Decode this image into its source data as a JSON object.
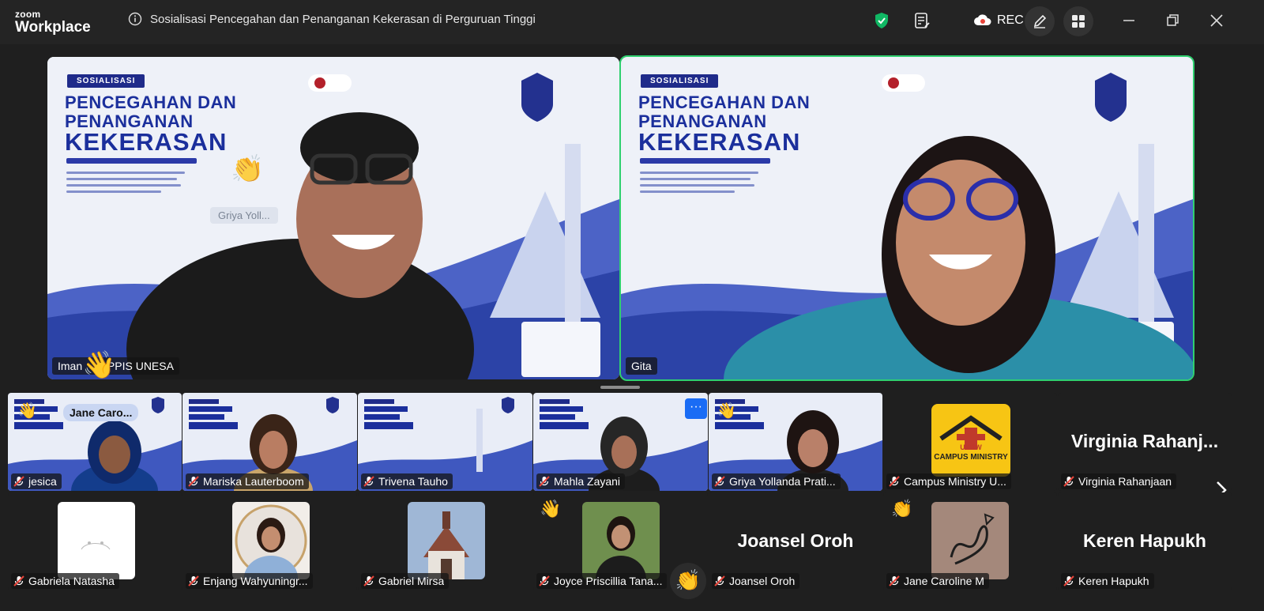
{
  "app": {
    "logo_small": "zoom",
    "logo_big": "Workplace",
    "meeting_title": "Sosialisasi Pencegahan dan Penanganan Kekerasan di Perguruan Tinggi",
    "rec_label": "REC"
  },
  "colors": {
    "active_speaker": "#2fd06f",
    "shield": "#10b864",
    "muted_mic": "#e8443a",
    "slide_navy": "#1b2f9c"
  },
  "slide": {
    "ribbon": "SOSIALISASI",
    "heading_line1": "PENCEGAHAN DAN",
    "heading_line2": "PENANGANAN",
    "heading_line3": "KEKERASAN"
  },
  "speakers": [
    {
      "name_start": "Iman",
      "name_end": "_PPIS UNESA",
      "reaction": "👋"
    },
    {
      "name": "Gita"
    }
  ],
  "stage_chip": "Griya  Yoll...",
  "gallery_row1": [
    {
      "name": "jesica",
      "hover": "Jane Caro...",
      "reaction": "👋"
    },
    {
      "name": "Mariska Lauterboom"
    },
    {
      "name": "Trivena Tauho"
    },
    {
      "name": "Mahla Zayani"
    },
    {
      "name": "Griya Yollanda Prati...",
      "reaction": "👋",
      "more": "···"
    },
    {
      "name": "Campus Ministry U...",
      "logo_text": "CAMPUS MINISTRY",
      "logo_sub": "UKSW"
    },
    {
      "name": "Virginia Rahanjaan",
      "big": "Virginia  Rahanj..."
    }
  ],
  "gallery_row2": [
    {
      "name": "Gabriela Natasha"
    },
    {
      "name": "Enjang Wahyuningr..."
    },
    {
      "name": "Gabriel Mirsa"
    },
    {
      "name": "Joyce Priscillia Tana...",
      "reaction": "👋"
    },
    {
      "name": "Joansel Oroh",
      "big": "Joansel Oroh"
    },
    {
      "name": "Jane Caroline M",
      "reaction": "👏"
    },
    {
      "name": "Keren Hapukh",
      "big": "Keren Hapukh"
    }
  ],
  "reactions_button": "👏",
  "icons": [
    "info-icon",
    "shield-icon",
    "notes-icon",
    "cloud-rec-icon",
    "annotate-icon",
    "apps-icon",
    "minimize-icon",
    "restore-icon",
    "close-icon",
    "mic-muted-icon",
    "chevron-right-icon"
  ]
}
